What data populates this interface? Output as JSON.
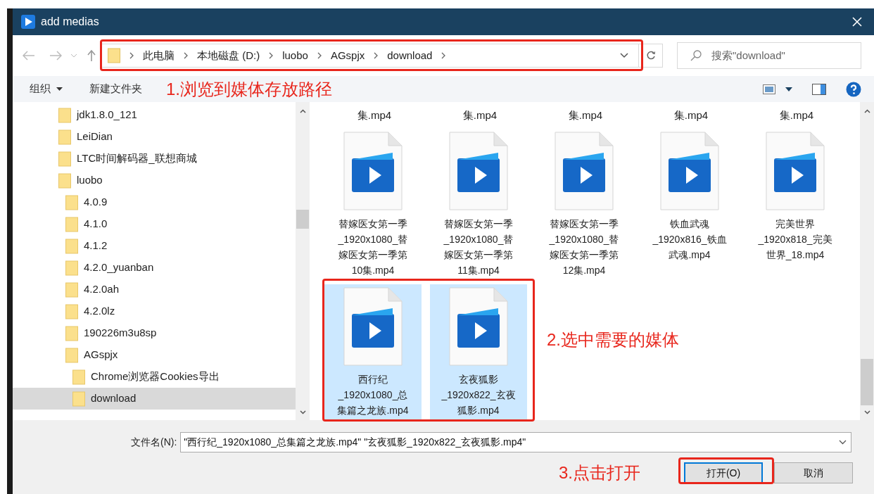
{
  "window": {
    "title": "add medias"
  },
  "address_bar": {
    "crumbs": [
      "此电脑",
      "本地磁盘 (D:)",
      "luobo",
      "AGspjx",
      "download"
    ]
  },
  "search": {
    "placeholder": "搜索\"download\""
  },
  "command_bar": {
    "organize": "组织",
    "new_folder": "新建文件夹"
  },
  "tree": [
    {
      "label": "jdk1.8.0_121",
      "selected": false
    },
    {
      "label": "LeiDian",
      "selected": false
    },
    {
      "label": "LTC时间解码器_联想商城",
      "selected": false
    },
    {
      "label": "luobo",
      "selected": false,
      "children": [
        {
          "label": "4.0.9",
          "selected": false
        },
        {
          "label": "4.1.0",
          "selected": false
        },
        {
          "label": "4.1.2",
          "selected": false
        },
        {
          "label": "4.2.0_yuanban",
          "selected": false
        },
        {
          "label": "4.2.0ah",
          "selected": false
        },
        {
          "label": "4.2.0lz",
          "selected": false
        },
        {
          "label": "190226m3u8sp",
          "selected": false
        },
        {
          "label": "AGspjx",
          "selected": false,
          "children": [
            {
              "label": "Chrome浏览器Cookies导出",
              "selected": false
            },
            {
              "label": "download",
              "selected": true
            }
          ]
        }
      ]
    }
  ],
  "partial_row": [
    "集.mp4",
    "集.mp4",
    "集.mp4",
    "集.mp4",
    "集.mp4"
  ],
  "files": [
    {
      "lines": [
        "替嫁医女第一季",
        "_1920x1080_替",
        "嫁医女第一季第",
        "10集.mp4"
      ],
      "selected": false
    },
    {
      "lines": [
        "替嫁医女第一季",
        "_1920x1080_替",
        "嫁医女第一季第",
        "11集.mp4"
      ],
      "selected": false
    },
    {
      "lines": [
        "替嫁医女第一季",
        "_1920x1080_替",
        "嫁医女第一季第",
        "12集.mp4"
      ],
      "selected": false
    },
    {
      "lines": [
        "铁血武魂",
        "_1920x816_铁血",
        "武魂.mp4"
      ],
      "selected": false
    },
    {
      "lines": [
        "完美世界",
        "_1920x818_完美",
        "世界_18.mp4"
      ],
      "selected": false
    },
    {
      "lines": [
        "西行纪",
        "_1920x1080_总",
        "集篇之龙族.mp4"
      ],
      "selected": true
    },
    {
      "lines": [
        "玄夜狐影",
        "_1920x822_玄夜",
        "狐影.mp4"
      ],
      "selected": true
    }
  ],
  "filename": {
    "label": "文件名(N):",
    "value": "\"西行纪_1920x1080_总集篇之龙族.mp4\" \"玄夜狐影_1920x822_玄夜狐影.mp4\""
  },
  "buttons": [
    {
      "label": "打开(O)",
      "kind": "primary"
    },
    {
      "label": "取消",
      "kind": "normal"
    }
  ],
  "annotations": [
    "1.浏览到媒体存放路径",
    "2.选中需要的媒体",
    "3.点击打开"
  ]
}
